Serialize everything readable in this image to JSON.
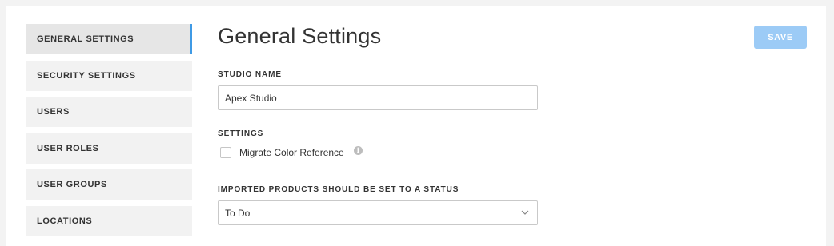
{
  "sidebar": {
    "items": [
      {
        "label": "GENERAL SETTINGS",
        "active": true
      },
      {
        "label": "SECURITY SETTINGS"
      },
      {
        "label": "USERS"
      },
      {
        "label": "USER ROLES"
      },
      {
        "label": "USER GROUPS"
      },
      {
        "label": "LOCATIONS"
      }
    ]
  },
  "main": {
    "title": "General Settings",
    "save_label": "SAVE",
    "studio_name_label": "STUDIO NAME",
    "studio_name_value": "Apex Studio",
    "settings_label": "SETTINGS",
    "migrate_label": "Migrate Color Reference",
    "migrate_checked": false,
    "info_icon": "i",
    "status_label": "IMPORTED PRODUCTS SHOULD BE SET TO A STATUS",
    "status_value": "To Do"
  },
  "colors": {
    "accent": "#3f9ae5",
    "save_button": "#9ccbf6",
    "sidebar_bg": "#f2f2f2",
    "sidebar_active_bg": "#e6e6e6"
  },
  "icons": {
    "info": "info-icon",
    "chevron": "chevron-down-icon"
  }
}
